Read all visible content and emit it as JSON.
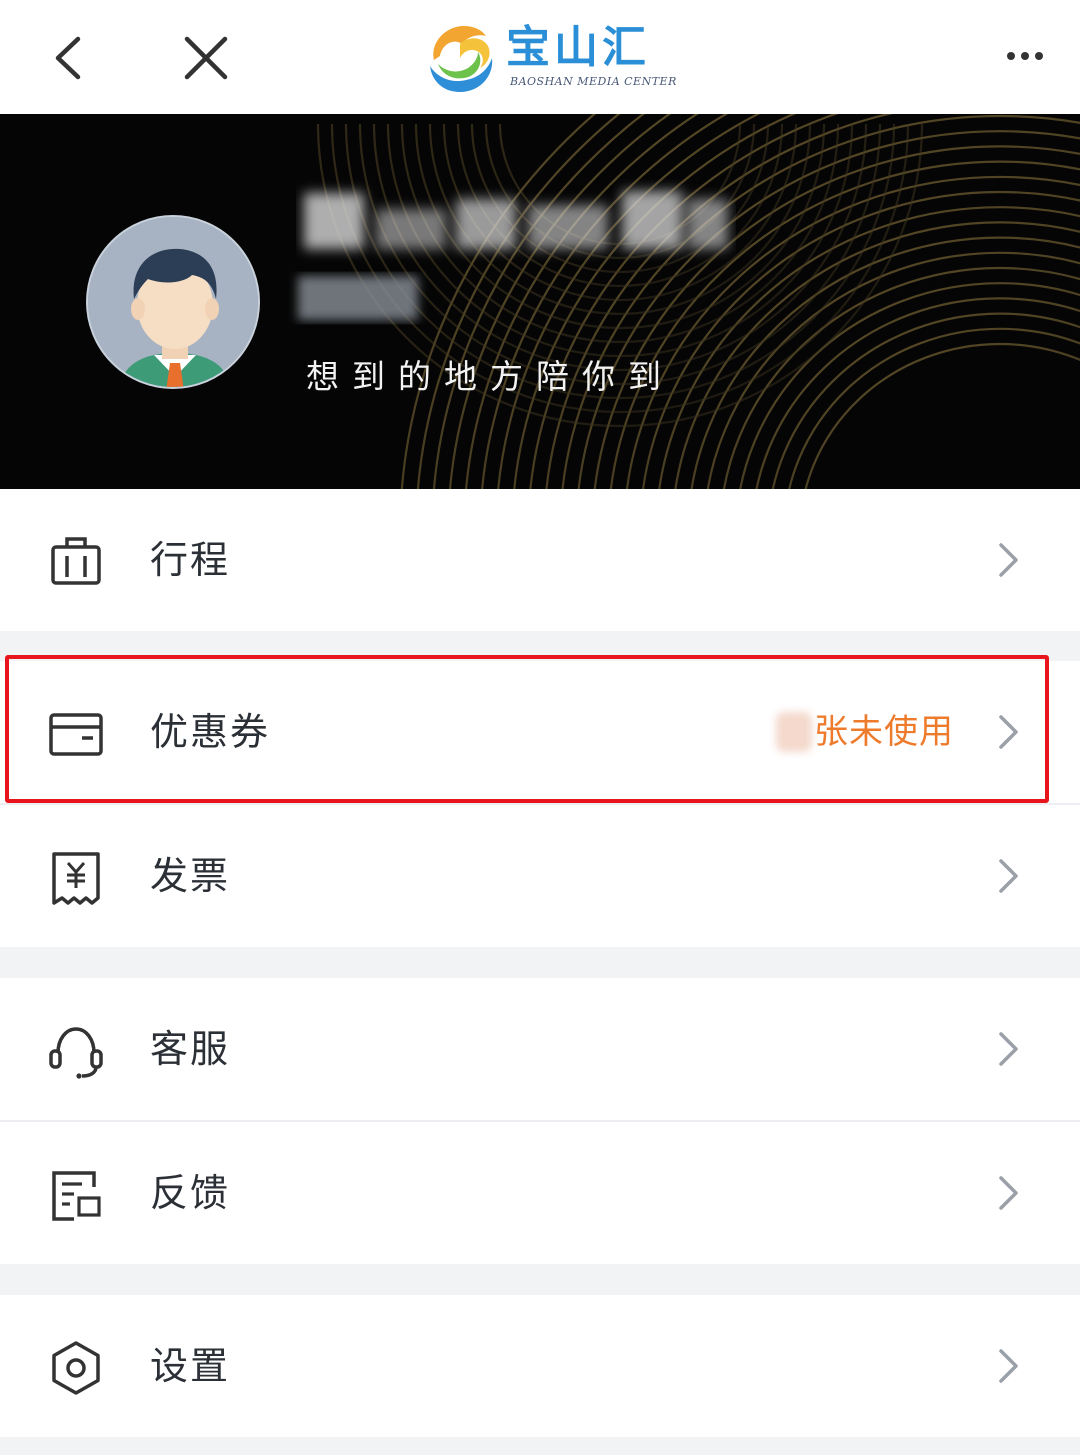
{
  "nav": {
    "back_icon": "chevron-left-icon",
    "close_icon": "close-icon",
    "more_icon": "more-dots-icon",
    "logo": {
      "name": "宝山汇",
      "subtitle": "BAOSHAN MEDIA CENTER"
    }
  },
  "profile": {
    "slogan": "想到的地方陪你到"
  },
  "menu": [
    {
      "label": "行程",
      "icon": "luggage-icon"
    },
    {
      "label": "优惠券",
      "icon": "wallet-icon",
      "badge": "张未使用",
      "badge_color": "#ee7b2c"
    },
    {
      "label": "发票",
      "icon": "invoice-icon"
    },
    {
      "label": "客服",
      "icon": "headset-icon"
    },
    {
      "label": "反馈",
      "icon": "feedback-icon"
    },
    {
      "label": "设置",
      "icon": "settings-icon"
    }
  ],
  "colors": {
    "accent_orange": "#ee7b2c",
    "highlight_red": "#e8161c",
    "logo_blue": "#2a8fd6"
  }
}
